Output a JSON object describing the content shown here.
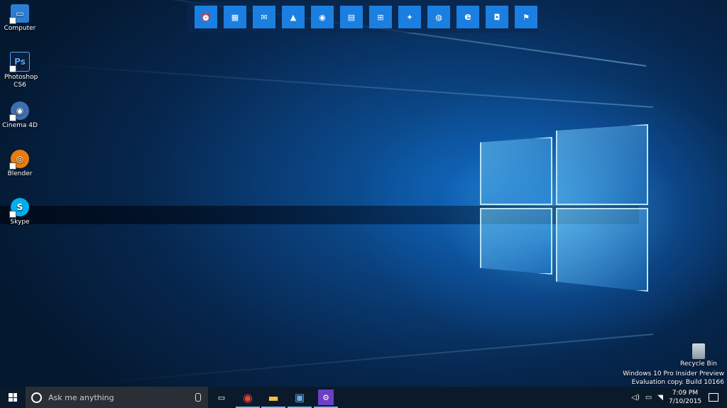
{
  "desktop": {
    "icons": [
      {
        "label": "Computer",
        "glyph": "▭",
        "color": "#2a7fd4"
      },
      {
        "label": "Photoshop CS6",
        "glyph": "Ps",
        "color": "#0e1f3a"
      },
      {
        "label": "Cinema 4D",
        "glyph": "◉",
        "color": "#3d6fae"
      },
      {
        "label": "Blender",
        "glyph": "◎",
        "color": "#e87d0d"
      },
      {
        "label": "Skype",
        "glyph": "S",
        "color": "#00aff0"
      }
    ],
    "recycle_bin": "Recycle Bin"
  },
  "toolbar": {
    "buttons": [
      {
        "name": "alarm-icon",
        "glyph": "⏰"
      },
      {
        "name": "calendar-icon",
        "glyph": "▦"
      },
      {
        "name": "mail-icon",
        "glyph": "✉"
      },
      {
        "name": "photos-icon",
        "glyph": "▲"
      },
      {
        "name": "groove-icon",
        "glyph": "◉"
      },
      {
        "name": "movies-icon",
        "glyph": "▤"
      },
      {
        "name": "store-icon",
        "glyph": "⊞"
      },
      {
        "name": "sports-icon",
        "glyph": "✦"
      },
      {
        "name": "maps-icon",
        "glyph": "◍"
      },
      {
        "name": "edge-icon",
        "glyph": "e"
      },
      {
        "name": "camera-icon",
        "glyph": "◘"
      },
      {
        "name": "people-icon",
        "glyph": "⚑"
      }
    ]
  },
  "watermark": {
    "line1": "Windows 10 Pro Insider Preview",
    "line2": "Evaluation copy. Build 10166"
  },
  "taskbar": {
    "search_placeholder": "Ask me anything",
    "apps": [
      {
        "name": "task-view-icon",
        "glyph": "▭",
        "color": "#ffffff"
      },
      {
        "name": "chrome-icon",
        "glyph": "◉",
        "color": "#e8453c"
      },
      {
        "name": "file-explorer-icon",
        "glyph": "▬",
        "color": "#f0c040"
      },
      {
        "name": "remote-desktop-icon",
        "glyph": "▣",
        "color": "#6aa9e8"
      },
      {
        "name": "settings-app-icon",
        "glyph": "⚙",
        "color": "#ffffff"
      }
    ],
    "clock_time": "7:09 PM",
    "clock_date": "7/10/2015"
  }
}
